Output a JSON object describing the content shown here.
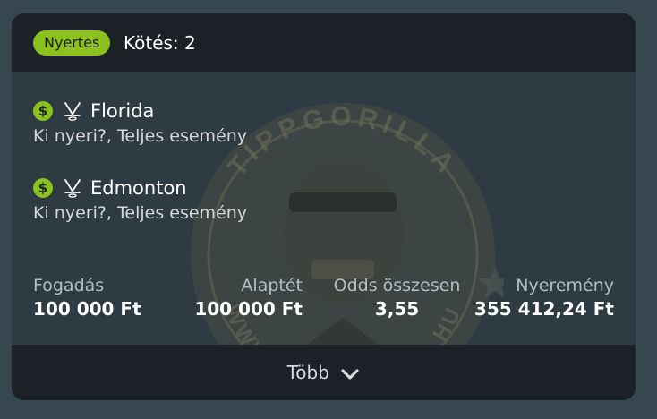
{
  "header": {
    "status_badge": "Nyertes",
    "bet_count": "Kötés: 2"
  },
  "selections": [
    {
      "icons": [
        "dollar-icon",
        "hockey-icon"
      ],
      "team": "Florida",
      "market": "Ki nyeri?, Teljes esemény"
    },
    {
      "icons": [
        "dollar-icon",
        "hockey-icon"
      ],
      "team": "Edmonton",
      "market": "Ki nyeri?, Teljes esemény"
    }
  ],
  "summary": {
    "stake_label": "Fogadás",
    "stake_value": "100 000 Ft",
    "base_label": "Alaptét",
    "base_value": "100 000 Ft",
    "odds_label": "Odds összesen",
    "odds_value": "3,55",
    "payout_label": "Nyeremény",
    "payout_value": "355 412,24 Ft"
  },
  "footer": {
    "more_label": "Több",
    "icon": "chevron-down-icon"
  },
  "watermark": {
    "top_text": "TIPPGORILLA",
    "bottom_text": "WWW.TIPPGORILLA.HU"
  },
  "colors": {
    "accent": "#8cc21e",
    "background": "#37474f",
    "card_body": "#2f3b43",
    "card_header": "#1b2126"
  }
}
